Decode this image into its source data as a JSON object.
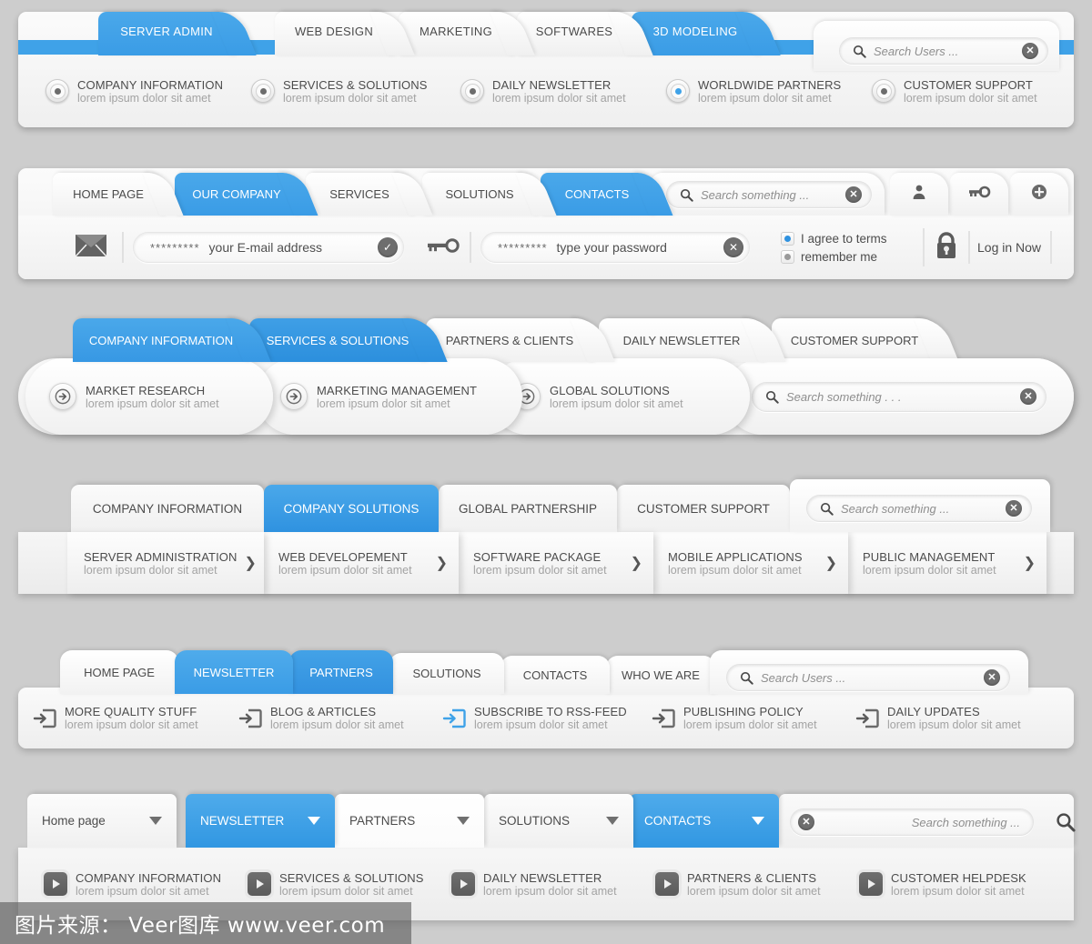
{
  "theme": {
    "accent": "#3fa2e8",
    "accent_dark": "#2f92e0",
    "page_bg": "#cdcdcd",
    "text": "#4c4c4c",
    "muted": "#a3a3a3"
  },
  "section1": {
    "tabs": [
      {
        "label": "SERVER ADMIN",
        "active": true
      },
      {
        "label": "WEB DESIGN",
        "active": false
      },
      {
        "label": "MARKETING",
        "active": false
      },
      {
        "label": "SOFTWARES",
        "active": false
      },
      {
        "label": "3D MODELING",
        "active": true
      }
    ],
    "search": {
      "placeholder": "Search Users ...",
      "icon": "search-icon",
      "clear": "✕"
    },
    "items": [
      {
        "title": "COMPANY INFORMATION",
        "subtitle": "lorem ipsum dolor sit amet",
        "selected": false
      },
      {
        "title": "SERVICES & SOLUTIONS",
        "subtitle": "lorem ipsum dolor sit amet",
        "selected": false
      },
      {
        "title": "DAILY NEWSLETTER",
        "subtitle": "lorem ipsum dolor sit amet",
        "selected": false
      },
      {
        "title": "WORLDWIDE PARTNERS",
        "subtitle": "lorem ipsum dolor sit amet",
        "selected": true
      },
      {
        "title": "CUSTOMER SUPPORT",
        "subtitle": "lorem ipsum dolor sit amet",
        "selected": false
      }
    ]
  },
  "section2": {
    "tabs": [
      {
        "label": "HOME PAGE",
        "active": false
      },
      {
        "label": "OUR COMPANY",
        "active": true
      },
      {
        "label": "SERVICES",
        "active": false
      },
      {
        "label": "SOLUTIONS",
        "active": false
      },
      {
        "label": "CONTACTS",
        "active": true
      }
    ],
    "search": {
      "placeholder": "Search something ...",
      "clear": "✕"
    },
    "icon_tabs": [
      "user-icon",
      "key-icon",
      "plus-icon"
    ],
    "email": {
      "stars": "*********",
      "label": "your E-mail address",
      "confirm": "✓",
      "icon": "envelope-icon"
    },
    "password": {
      "stars": "*********",
      "label": "type your password",
      "clear": "✕",
      "icon": "key-icon"
    },
    "checkboxes": [
      {
        "label": "I agree to terms",
        "checked": true
      },
      {
        "label": "remember me",
        "checked": false
      }
    ],
    "login": {
      "label": "Log in Now",
      "icon": "lock-icon"
    }
  },
  "section3": {
    "tabs": [
      {
        "label": "COMPANY INFORMATION",
        "active": true
      },
      {
        "label": "SERVICES & SOLUTIONS",
        "active": true
      },
      {
        "label": "PARTNERS & CLIENTS",
        "active": false
      },
      {
        "label": "DAILY NEWSLETTER",
        "active": false
      },
      {
        "label": "CUSTOMER SUPPORT",
        "active": false
      }
    ],
    "cards": [
      {
        "title": "MARKET RESEARCH",
        "subtitle": "lorem ipsum dolor sit amet"
      },
      {
        "title": "MARKETING MANAGEMENT",
        "subtitle": "lorem ipsum dolor sit amet"
      },
      {
        "title": "GLOBAL SOLUTIONS",
        "subtitle": "lorem ipsum dolor sit amet"
      }
    ],
    "search": {
      "placeholder": "Search something . . .",
      "clear": "✕"
    }
  },
  "section4": {
    "tabs": [
      {
        "label": "COMPANY INFORMATION",
        "active": false
      },
      {
        "label": "COMPANY SOLUTIONS",
        "active": true
      },
      {
        "label": "GLOBAL PARTNERSHIP",
        "active": false
      },
      {
        "label": "CUSTOMER SUPPORT",
        "active": false
      }
    ],
    "search": {
      "placeholder": "Search something ...",
      "clear": "✕"
    },
    "items": [
      {
        "title": "SERVER ADMINISTRATION",
        "subtitle": "lorem ipsum dolor sit amet",
        "chevron": "❯"
      },
      {
        "title": "WEB DEVELOPEMENT",
        "subtitle": "lorem ipsum dolor sit amet",
        "chevron": "❯"
      },
      {
        "title": "SOFTWARE PACKAGE",
        "subtitle": "lorem ipsum dolor sit amet",
        "chevron": "❯"
      },
      {
        "title": "MOBILE APPLICATIONS",
        "subtitle": "lorem ipsum dolor sit amet",
        "chevron": "❯"
      },
      {
        "title": "PUBLIC MANAGEMENT",
        "subtitle": "lorem ipsum dolor sit amet",
        "chevron": "❯"
      }
    ]
  },
  "section5": {
    "tabs": [
      {
        "label": "HOME PAGE",
        "active": false
      },
      {
        "label": "NEWSLETTER",
        "active": true
      },
      {
        "label": "PARTNERS",
        "active": true
      },
      {
        "label": "SOLUTIONS",
        "active": false
      },
      {
        "label": "CONTACTS",
        "active": false
      },
      {
        "label": "WHO WE ARE",
        "active": false
      }
    ],
    "search": {
      "placeholder": "Search Users ...",
      "clear": "✕"
    },
    "items": [
      {
        "title": "MORE QUALITY STUFF",
        "subtitle": "lorem ipsum dolor sit amet",
        "highlight": false
      },
      {
        "title": "BLOG & ARTICLES",
        "subtitle": "lorem ipsum dolor sit amet",
        "highlight": false
      },
      {
        "title": "SUBSCRIBE TO RSS-FEED",
        "subtitle": "lorem ipsum dolor sit amet",
        "highlight": true
      },
      {
        "title": "PUBLISHING POLICY",
        "subtitle": "lorem ipsum dolor sit amet",
        "highlight": false
      },
      {
        "title": "DAILY UPDATES",
        "subtitle": "lorem ipsum dolor sit amet",
        "highlight": false
      }
    ]
  },
  "section6": {
    "tabs": [
      {
        "label": "Home page",
        "active": false
      },
      {
        "label": "NEWSLETTER",
        "active": true
      },
      {
        "label": "PARTNERS",
        "active": false
      },
      {
        "label": "SOLUTIONS",
        "active": false
      },
      {
        "label": "CONTACTS",
        "active": true
      }
    ],
    "search": {
      "placeholder": "Search something ...",
      "clear": "✕"
    },
    "items": [
      {
        "title": "COMPANY INFORMATION",
        "subtitle": "lorem ipsum dolor sit amet"
      },
      {
        "title": "SERVICES & SOLUTIONS",
        "subtitle": "lorem ipsum dolor sit amet"
      },
      {
        "title": "DAILY NEWSLETTER",
        "subtitle": "lorem ipsum dolor sit amet"
      },
      {
        "title": "PARTNERS & CLIENTS",
        "subtitle": "lorem ipsum dolor sit amet"
      },
      {
        "title": "CUSTOMER HELPDESK",
        "subtitle": "lorem ipsum dolor sit amet"
      }
    ]
  },
  "watermark": {
    "text": "图片来源： Veer图库 www.veer.com"
  }
}
